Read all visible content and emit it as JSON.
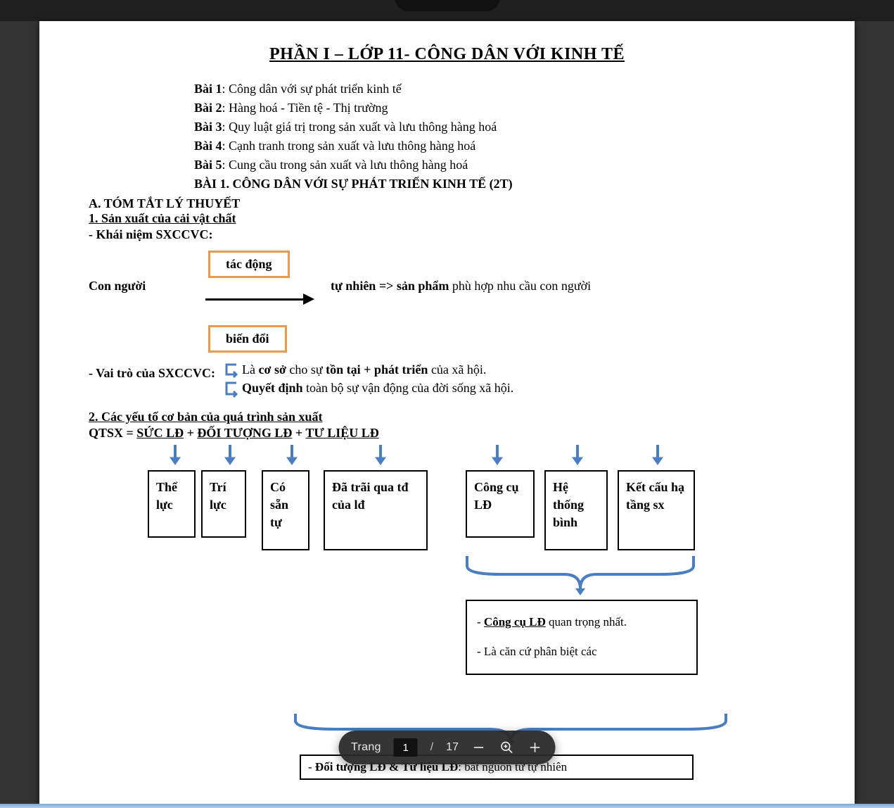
{
  "title": "PHẦN I – LỚP 11-  CÔNG DÂN VỚI KINH TẾ",
  "lessons": {
    "l1_b": "Bài 1",
    "l1_t": ": Công dân với sự phát triển kinh tế",
    "l2_b": "Bài 2",
    "l2_t": ": Hàng hoá - Tiền tệ - Thị trường",
    "l3_b": "Bài 3",
    "l3_t": ": Quy luật giá trị trong sản xuất và lưu thông hàng hoá",
    "l4_b": "Bài 4",
    "l4_t": ": Cạnh tranh trong sản xuất và lưu thông hàng hoá",
    "l5_b": "Bài 5",
    "l5_t": ": Cung cầu trong sản xuất và lưu thông hàng hoá",
    "l_title": "BÀI 1. CÔNG DÂN VỚI SỰ PHÁT TRIỂN KINH TẾ (2T)"
  },
  "secA": "A. TÓM TẮT LÝ THUYẾT",
  "sub1": "1. Sản xuất của cải vật chất",
  "khai": "- Khái niệm SXCCVC:",
  "d1": {
    "con": "Con người",
    "tac": "tác động",
    "bien": "biến đổi",
    "tu_nhien": "tự nhiên => ",
    "san_pham": "sản phẩm",
    "rest": " phù hợp nhu cầu con người"
  },
  "vaitro": {
    "label": "- Vai trò của SXCCVC:",
    "l1a": "Là ",
    "l1b": "cơ sở",
    "l1c": " cho sự ",
    "l1d": "tồn tại + phát triển",
    "l1e": " của xã hội.",
    "l2a": "Quyết định",
    "l2b": " toàn bộ sự vận động của đời sống xã hội."
  },
  "sub2": "2. Các yếu tố cơ bản của quá trình sản xuất",
  "qtsx": {
    "left": "QTSX =  ",
    "suc": "SỨC   LĐ",
    "plus1": " +       ",
    "doi": "ĐỐI TƯỢNG LĐ",
    "plus2": "           +            ",
    "tu": "TƯ LIỆU LĐ"
  },
  "boxes": {
    "b1": "Thể lực",
    "b2": "Trí lực",
    "b3": "Có sẵn tự",
    "b4": "Đã trãi qua tđ của lđ",
    "b5": "Công cụ LĐ",
    "b6": "Hệ thống bình",
    "b7": "Kết cấu hạ tầng sx"
  },
  "note": {
    "l1a": "- ",
    "l1u": "Công cụ LĐ",
    "l1b": " quan trọng nhất.",
    "l2": "- Là căn cứ phân biệt các"
  },
  "bottom_box": {
    "pre": "- ",
    "b": "Đối tượng LĐ & Tư liệu LĐ",
    "post": ": bắt nguồn từ tự nhiên"
  },
  "toolbar": {
    "page_label": "Trang",
    "page_current": "1",
    "page_sep": "/",
    "page_total": "17"
  }
}
